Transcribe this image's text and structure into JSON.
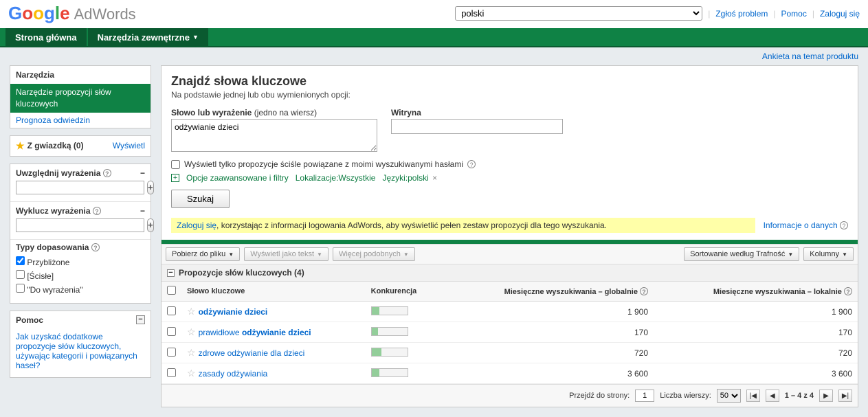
{
  "header": {
    "product": "AdWords",
    "language": "polski",
    "links": {
      "report": "Zgłoś problem",
      "help": "Pomoc",
      "login": "Zaloguj się"
    }
  },
  "nav": {
    "home": "Strona główna",
    "tools": "Narzędzia zewnętrzne"
  },
  "survey_link": "Ankieta na temat produktu",
  "sidebar": {
    "tools_h": "Narzędzia",
    "selected_tool": "Narzędzie propozycji słów kluczowych",
    "traffic_link": "Prognoza odwiedzin",
    "starred_label": "Z gwiazdką (0)",
    "show_link": "Wyświetl",
    "include_label": "Uwzględnij wyrażenia",
    "exclude_label": "Wyklucz wyrażenia",
    "match_label": "Typy dopasowania",
    "match_broad": "Przybliżone",
    "match_exact": "[Ścisłe]",
    "match_phrase": "\"Do wyrażenia\"",
    "help_h": "Pomoc",
    "help_link": "Jak uzyskać dodatkowe propozycje słów kluczowych, używając kategorii i powiązanych haseł?"
  },
  "content": {
    "title": "Znajdź słowa kluczowe",
    "subtitle": "Na podstawie jednej lub obu wymienionych opcji:",
    "phrase_label_b": "Słowo lub wyrażenie",
    "phrase_label_hint": " (jedno na wiersz)",
    "phrase_value": "odżywianie dzieci",
    "site_label": "Witryna",
    "site_value": "",
    "only_close": "Wyświetl tylko propozycje ściśle powiązane z moimi wyszukiwanymi hasłami",
    "adv_filters": "Opcje zaawansowane i filtry",
    "loc_chip": "Lokalizacje:Wszystkie",
    "lang_chip": "Języki:polski",
    "search_btn": "Szukaj",
    "notice_login": "Zaloguj się",
    "notice_rest": ", korzystając z informacji logowania AdWords, aby wyświetlić pełen zestaw propozycji dla tego wyszukania.",
    "info_link": "Informacje o danych"
  },
  "toolbar": {
    "download": "Pobierz do pliku",
    "as_text": "Wyświetl jako tekst",
    "more_like": "Więcej podobnych",
    "sort_by": "Sortowanie według Trafność",
    "columns": "Kolumny"
  },
  "results": {
    "section_title": "Propozycje słów kluczowych (4)",
    "columns": {
      "keyword": "Słowo kluczowe",
      "competition": "Konkurencja",
      "global": "Miesięczne wyszukiwania – globalnie",
      "local": "Miesięczne wyszukiwania – lokalnie"
    },
    "rows": [
      {
        "kw_pre": "",
        "kw_hl": "odżywianie dzieci",
        "kw_post": "",
        "comp": 22,
        "global": "1 900",
        "local": "1 900"
      },
      {
        "kw_pre": "prawidłowe ",
        "kw_hl": "odżywianie dzieci",
        "kw_post": "",
        "comp": 18,
        "global": "170",
        "local": "170"
      },
      {
        "kw_pre": "zdrowe odżywianie dla dzieci",
        "kw_hl": "",
        "kw_post": "",
        "comp": 28,
        "global": "720",
        "local": "720"
      },
      {
        "kw_pre": "zasady odżywiania",
        "kw_hl": "",
        "kw_post": "",
        "comp": 22,
        "global": "3 600",
        "local": "3 600"
      }
    ]
  },
  "pager": {
    "goto": "Przejdź do strony:",
    "page": "1",
    "rows_label": "Liczba wierszy:",
    "rows": "50",
    "range": "1 – 4 z 4"
  }
}
